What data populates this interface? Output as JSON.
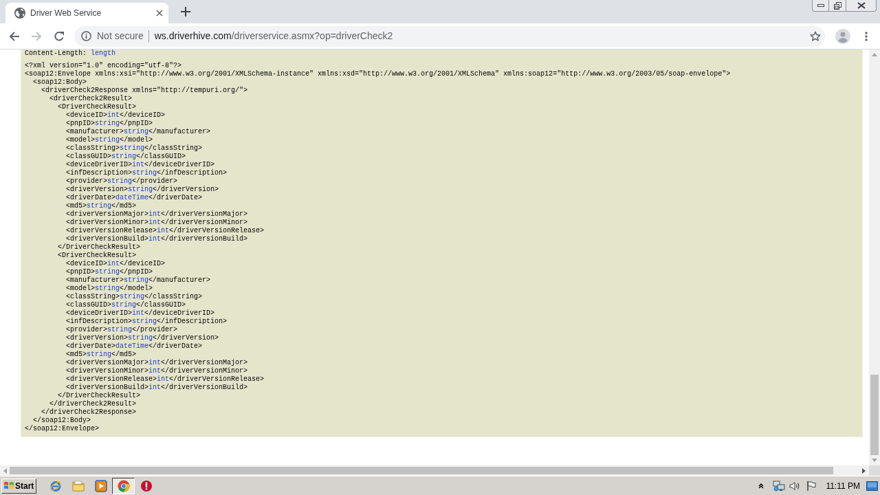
{
  "tabs": [
    {
      "title": "Driver Web Service",
      "selected": true
    }
  ],
  "navigation": {
    "back_disabled": false,
    "forward_disabled": true
  },
  "address_bar": {
    "security_label": "Not secure",
    "host": "ws.driverhive.com",
    "path": "/driverservice.asmx?op=driverCheck2"
  },
  "http_headers": [
    {
      "name": "Content-Length:",
      "value": "length"
    }
  ],
  "xml": {
    "declaration": "<?xml version=\"1.0\" encoding=\"utf-8\"?>",
    "nodes": [
      {
        "open": "<soap12:Envelope xmlns:xsi=\"http://www.w3.org/2001/XMLSchema-instance\" xmlns:xsd=\"http://www.w3.org/2001/XMLSchema\" xmlns:soap12=\"http://www.w3.org/2003/05/soap-envelope\">",
        "close": "</soap12:Envelope>",
        "children": [
          {
            "open": "<soap12:Body>",
            "close": "</soap12:Body>",
            "children": [
              {
                "open": "<driverCheck2Response xmlns=\"http://tempuri.org/\">",
                "close": "</driverCheck2Response>",
                "children": [
                  {
                    "open": "<driverCheck2Result>",
                    "close": "</driverCheck2Result>",
                    "children": [
                      {
                        "open": "<DriverCheckResult>",
                        "close": "</DriverCheckResult>",
                        "children": [
                          {
                            "open": "<deviceID>",
                            "value": "int",
                            "close": "</deviceID>"
                          },
                          {
                            "open": "<pnpID>",
                            "value": "string",
                            "close": "</pnpID>"
                          },
                          {
                            "open": "<manufacturer>",
                            "value": "string",
                            "close": "</manufacturer>"
                          },
                          {
                            "open": "<model>",
                            "value": "string",
                            "close": "</model>"
                          },
                          {
                            "open": "<classString>",
                            "value": "string",
                            "close": "</classString>"
                          },
                          {
                            "open": "<classGUID>",
                            "value": "string",
                            "close": "</classGUID>"
                          },
                          {
                            "open": "<deviceDriverID>",
                            "value": "int",
                            "close": "</deviceDriverID>"
                          },
                          {
                            "open": "<infDescription>",
                            "value": "string",
                            "close": "</infDescription>"
                          },
                          {
                            "open": "<provider>",
                            "value": "string",
                            "close": "</provider>"
                          },
                          {
                            "open": "<driverVersion>",
                            "value": "string",
                            "close": "</driverVersion>"
                          },
                          {
                            "open": "<driverDate>",
                            "value": "dateTime",
                            "close": "</driverDate>"
                          },
                          {
                            "open": "<md5>",
                            "value": "string",
                            "close": "</md5>"
                          },
                          {
                            "open": "<driverVersionMajor>",
                            "value": "int",
                            "close": "</driverVersionMajor>"
                          },
                          {
                            "open": "<driverVersionMinor>",
                            "value": "int",
                            "close": "</driverVersionMinor>"
                          },
                          {
                            "open": "<driverVersionRelease>",
                            "value": "int",
                            "close": "</driverVersionRelease>"
                          },
                          {
                            "open": "<driverVersionBuild>",
                            "value": "int",
                            "close": "</driverVersionBuild>"
                          }
                        ]
                      },
                      {
                        "open": "<DriverCheckResult>",
                        "close": "</DriverCheckResult>",
                        "children": [
                          {
                            "open": "<deviceID>",
                            "value": "int",
                            "close": "</deviceID>"
                          },
                          {
                            "open": "<pnpID>",
                            "value": "string",
                            "close": "</pnpID>"
                          },
                          {
                            "open": "<manufacturer>",
                            "value": "string",
                            "close": "</manufacturer>"
                          },
                          {
                            "open": "<model>",
                            "value": "string",
                            "close": "</model>"
                          },
                          {
                            "open": "<classString>",
                            "value": "string",
                            "close": "</classString>"
                          },
                          {
                            "open": "<classGUID>",
                            "value": "string",
                            "close": "</classGUID>"
                          },
                          {
                            "open": "<deviceDriverID>",
                            "value": "int",
                            "close": "</deviceDriverID>"
                          },
                          {
                            "open": "<infDescription>",
                            "value": "string",
                            "close": "</infDescription>"
                          },
                          {
                            "open": "<provider>",
                            "value": "string",
                            "close": "</provider>"
                          },
                          {
                            "open": "<driverVersion>",
                            "value": "string",
                            "close": "</driverVersion>"
                          },
                          {
                            "open": "<driverDate>",
                            "value": "dateTime",
                            "close": "</driverDate>"
                          },
                          {
                            "open": "<md5>",
                            "value": "string",
                            "close": "</md5>"
                          },
                          {
                            "open": "<driverVersionMajor>",
                            "value": "int",
                            "close": "</driverVersionMajor>"
                          },
                          {
                            "open": "<driverVersionMinor>",
                            "value": "int",
                            "close": "</driverVersionMinor>"
                          },
                          {
                            "open": "<driverVersionRelease>",
                            "value": "int",
                            "close": "</driverVersionRelease>"
                          },
                          {
                            "open": "<driverVersionBuild>",
                            "value": "int",
                            "close": "</driverVersionBuild>"
                          }
                        ]
                      }
                    ]
                  }
                ]
              }
            ]
          }
        ]
      }
    ]
  },
  "taskbar": {
    "start_label": "Start",
    "buttons": [
      {
        "selected": false
      },
      {
        "selected": false
      },
      {
        "selected": false
      },
      {
        "selected": true
      },
      {
        "selected": false
      }
    ],
    "clock": "11:11 PM"
  }
}
